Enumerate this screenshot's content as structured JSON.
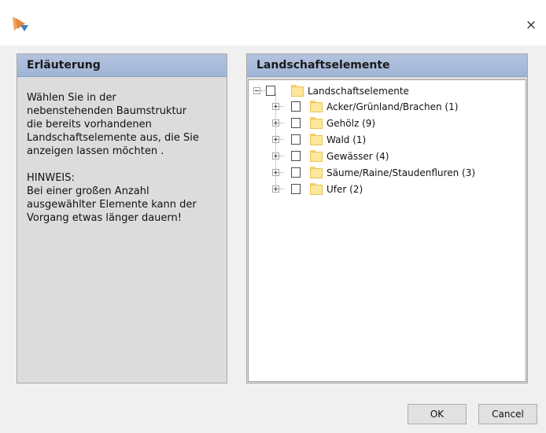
{
  "window": {
    "app_icon": "app-logo-icon",
    "close_glyph": "×"
  },
  "left_panel": {
    "title": "Erläuterung",
    "text": "Wählen Sie in der\nnebenstehenden Baumstruktur\ndie bereits vorhandenen\nLandschaftselemente aus, die Sie\nanzeigen lassen möchten .\n\nHINWEIS:\nBei einer großen Anzahl\nausgewählter Elemente kann der\nVorgang etwas länger dauern!"
  },
  "right_panel": {
    "title": "Landschaftselemente",
    "tree": {
      "root": {
        "label": "Landschaftselemente",
        "expanded": true,
        "checked": false
      },
      "children": [
        {
          "label": "Acker/Grünland/Brachen (1)",
          "expanded": false,
          "checked": false
        },
        {
          "label": "Gehölz (9)",
          "expanded": false,
          "checked": false
        },
        {
          "label": "Wald (1)",
          "expanded": false,
          "checked": false
        },
        {
          "label": "Gewässer (4)",
          "expanded": false,
          "checked": false
        },
        {
          "label": "Säume/Raine/Staudenfluren (3)",
          "expanded": false,
          "checked": false
        },
        {
          "label": "Ufer (2)",
          "expanded": false,
          "checked": false
        }
      ]
    }
  },
  "buttons": {
    "ok": "OK",
    "cancel": "Cancel"
  }
}
